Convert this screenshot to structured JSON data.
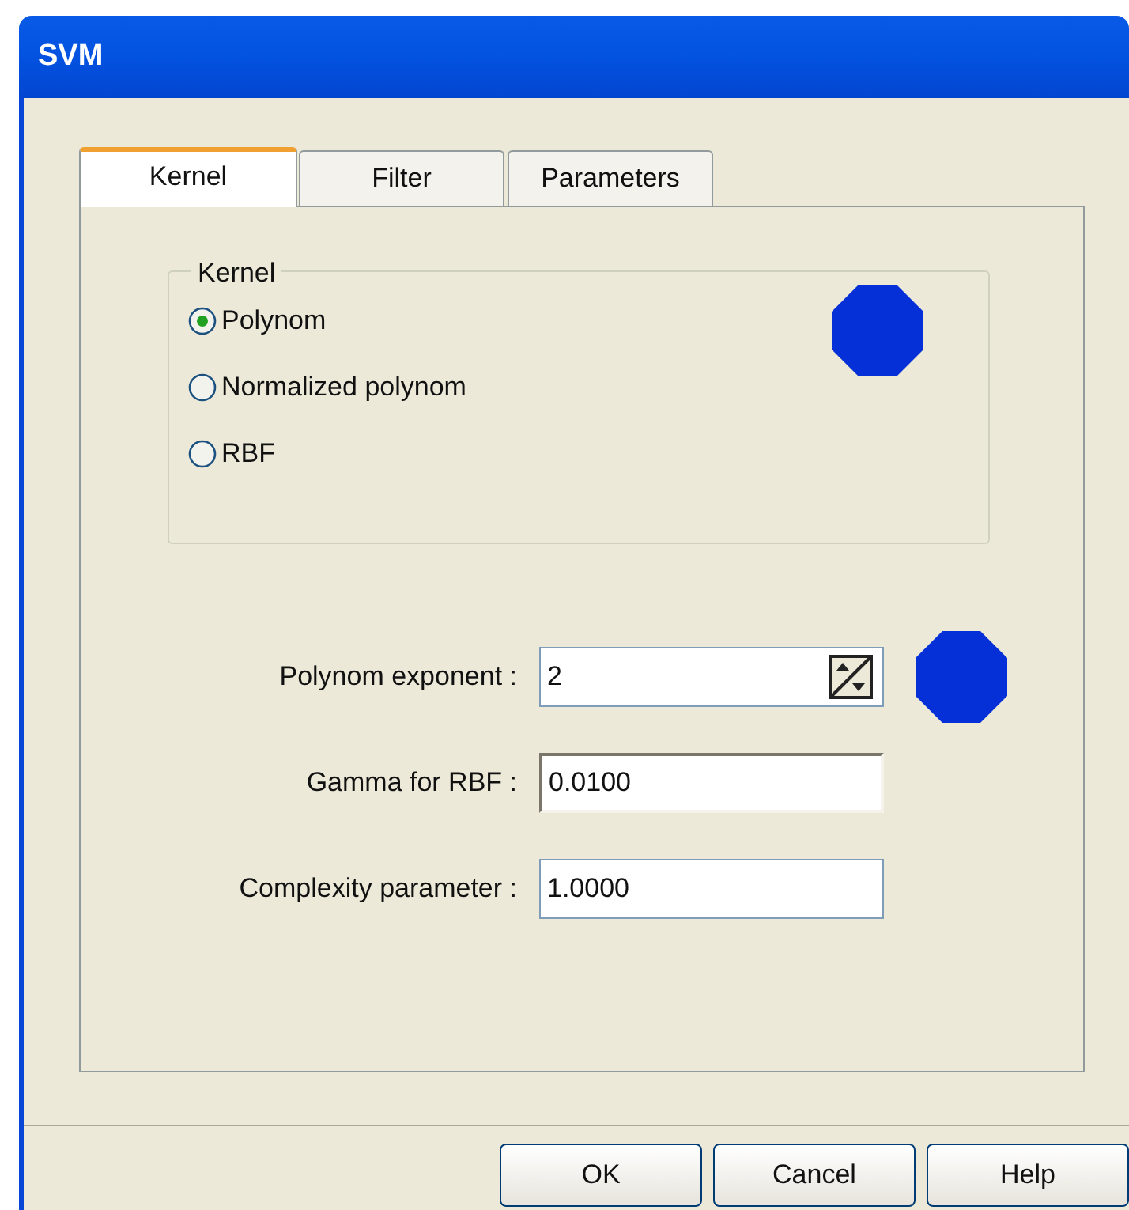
{
  "window": {
    "title": "SVM"
  },
  "tabs": [
    {
      "label": "Kernel",
      "selected": true
    },
    {
      "label": "Filter",
      "selected": false
    },
    {
      "label": "Parameters",
      "selected": false
    }
  ],
  "kernel_group": {
    "title": "Kernel",
    "options": [
      {
        "label": "Polynom",
        "selected": true
      },
      {
        "label": "Normalized polynom",
        "selected": false
      },
      {
        "label": "RBF",
        "selected": false
      }
    ]
  },
  "fields": [
    {
      "label": "Polynom exponent :",
      "value": "2",
      "kind": "spin"
    },
    {
      "label": "Gamma for RBF :",
      "value": "0.0100",
      "kind": "sunken"
    },
    {
      "label": "Complexity parameter :",
      "value": "1.0000",
      "kind": "text"
    }
  ],
  "buttons": [
    "OK",
    "Cancel",
    "Help"
  ]
}
